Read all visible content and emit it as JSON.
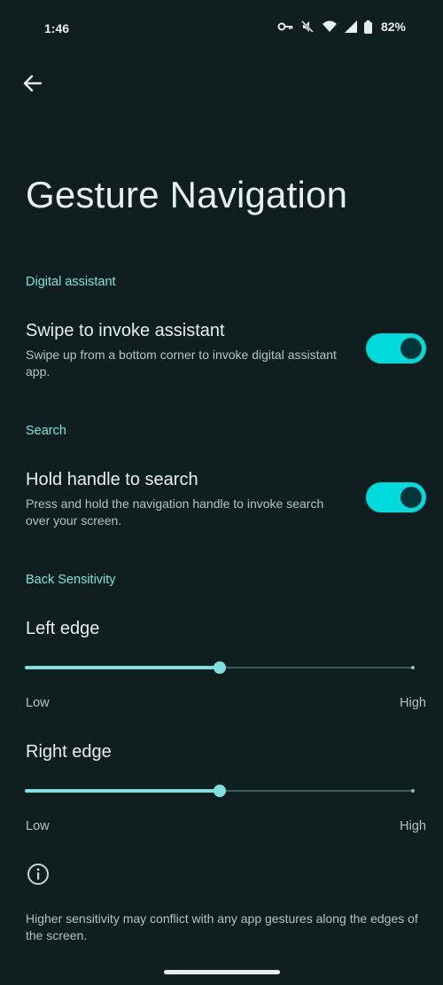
{
  "status_bar": {
    "time": "1:46",
    "battery": "82%",
    "icons": [
      "vpn-key-icon",
      "mute-icon",
      "wifi-icon",
      "signal-icon",
      "battery-icon"
    ]
  },
  "page": {
    "title": "Gesture Navigation"
  },
  "sections": {
    "digital_assistant": {
      "header": "Digital assistant",
      "title": "Swipe to invoke assistant",
      "description": "Swipe up from a bottom corner to invoke digital assistant app.",
      "enabled": true
    },
    "search": {
      "header": "Search",
      "title": "Hold handle to search",
      "description": "Press and hold the navigation handle to invoke search over your screen.",
      "enabled": true
    },
    "back_sensitivity": {
      "header": "Back Sensitivity",
      "left_edge": {
        "label": "Left edge",
        "value": 0.5,
        "low": "Low",
        "high": "High"
      },
      "right_edge": {
        "label": "Right edge",
        "value": 0.5,
        "low": "Low",
        "high": "High"
      }
    }
  },
  "footer": {
    "note": "Higher sensitivity may conflict with any app gestures along the edges of the screen."
  },
  "colors": {
    "background": "#0f1f1f",
    "accent": "#7fe0e0",
    "toggle_on": "#00dada"
  }
}
